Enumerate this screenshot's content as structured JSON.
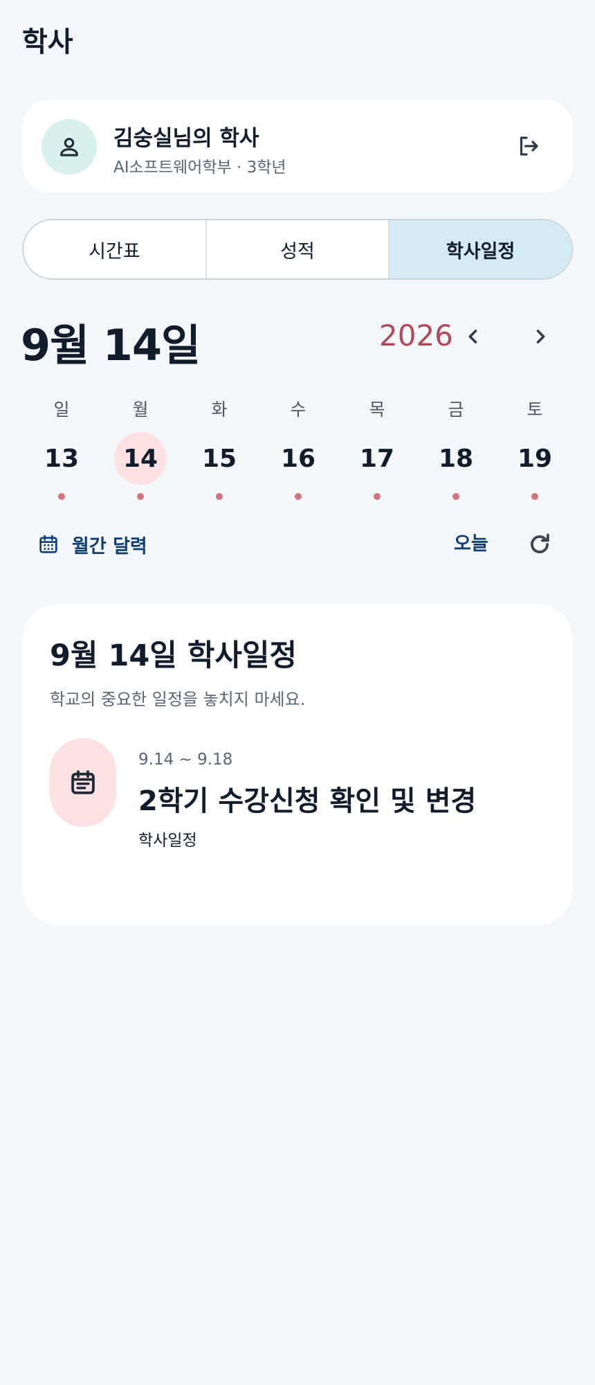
{
  "header": {
    "title": "학사"
  },
  "profile": {
    "name": "김숭실님의 학사",
    "subtitle": "AI소프트웨어학부 · 3학년",
    "avatar_icon": "person-icon",
    "logout_icon": "logout-icon"
  },
  "tabs": [
    {
      "label": "시간표",
      "active": false
    },
    {
      "label": "성적",
      "active": false
    },
    {
      "label": "학사일정",
      "active": true
    }
  ],
  "date_header": {
    "title": "9월 14일",
    "year": "2026",
    "prev_icon": "chevron-left-icon",
    "next_icon": "chevron-right-icon"
  },
  "week": [
    {
      "dow": "일",
      "day": "13",
      "selected": false,
      "has_event": true
    },
    {
      "dow": "월",
      "day": "14",
      "selected": true,
      "has_event": true
    },
    {
      "dow": "화",
      "day": "15",
      "selected": false,
      "has_event": true
    },
    {
      "dow": "수",
      "day": "16",
      "selected": false,
      "has_event": true
    },
    {
      "dow": "목",
      "day": "17",
      "selected": false,
      "has_event": true
    },
    {
      "dow": "금",
      "day": "18",
      "selected": false,
      "has_event": true
    },
    {
      "dow": "토",
      "day": "19",
      "selected": false,
      "has_event": true
    }
  ],
  "actions": {
    "month_calendar_label": "월간 달력",
    "month_calendar_icon": "calendar-icon",
    "today_label": "오늘",
    "refresh_icon": "refresh-icon"
  },
  "schedule": {
    "title": "9월 14일 학사일정",
    "subtitle": "학교의 중요한 일정을 놓치지 마세요.",
    "events": [
      {
        "date_range": "9.14 ~ 9.18",
        "title": "2학기 수강신청 확인 및 변경",
        "category": "학사일정",
        "icon": "event-note-icon"
      }
    ]
  },
  "colors": {
    "background": "#f4f7f9",
    "accent_navy": "#0e3e72",
    "selected_day_bg": "#fde1e3",
    "active_tab_bg": "#d3ebf4",
    "avatar_bg": "#d7f2ec",
    "year_color": "#b04a5a",
    "event_dot": "#d1767f"
  }
}
